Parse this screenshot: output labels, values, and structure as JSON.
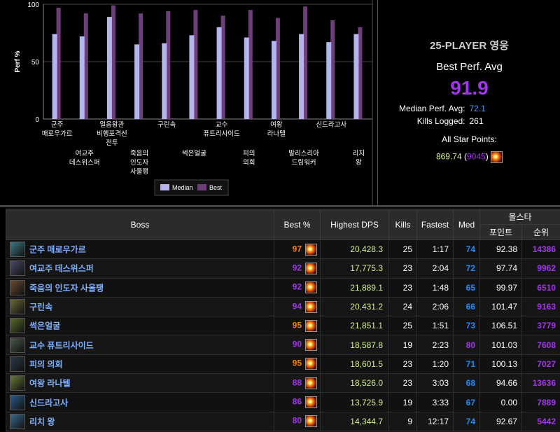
{
  "chart_data": {
    "type": "bar",
    "ylabel": "Perf %",
    "ylim": [
      0,
      100
    ],
    "yticks": [
      "0",
      "50",
      "100"
    ],
    "categories": [
      [
        "군주",
        "매로우가르"
      ],
      [
        "여교주",
        "데스위스퍼"
      ],
      [
        "얼음왕관",
        "비행포격선",
        "전투"
      ],
      [
        "죽음의",
        "인도자",
        "사울팽"
      ],
      [
        "구린속"
      ],
      [
        "썩은얼굴"
      ],
      [
        "교수",
        "퓨트리사이드"
      ],
      [
        "피의",
        "의회"
      ],
      [
        "여왕",
        "라나텔"
      ],
      [
        "발리스리아",
        "드림워커"
      ],
      [
        "신드라고사"
      ],
      [
        "리치",
        "왕"
      ]
    ],
    "series": [
      {
        "name": "Median",
        "values": [
          74,
          72,
          89,
          65,
          66,
          73,
          80,
          71,
          68,
          74,
          67,
          74
        ],
        "color": "#b4b4ee"
      },
      {
        "name": "Best",
        "values": [
          97,
          92,
          99,
          92,
          94,
          95,
          90,
          95,
          88,
          98,
          86,
          80
        ],
        "color": "#6e3e78"
      }
    ],
    "legend_placement": "bottom-center"
  },
  "stats": {
    "mode": "25-PLAYER 영웅",
    "best_perf_label": "Best Perf. Avg",
    "best_perf_value": "91.9",
    "median_label": "Median Perf. Avg:",
    "median_value": "72.1",
    "kills_label": "Kills Logged:",
    "kills_value": "261",
    "allstar_label": "All Star Points:",
    "allstar_points": "869.74",
    "allstar_rank": "9045"
  },
  "table": {
    "headers": {
      "boss": "Boss",
      "best": "Best %",
      "dps": "Highest DPS",
      "kills": "Kills",
      "fastest": "Fastest",
      "med": "Med",
      "allstar": "올스타",
      "points": "포인트",
      "rank": "순위"
    },
    "rows": [
      {
        "name": "군주 매로우가르",
        "best": "97",
        "best_color": "#ff8000",
        "dps": "20,428.3",
        "kills": "25",
        "fastest": "1:17",
        "med": "74",
        "med_color": "#1a8cff",
        "points": "92.38",
        "rank": "14386",
        "icon": "#3c7a86"
      },
      {
        "name": "여교주 데스위스퍼",
        "best": "92",
        "best_color": "#a335ee",
        "dps": "17,775.3",
        "kills": "23",
        "fastest": "2:04",
        "med": "72",
        "med_color": "#1a8cff",
        "points": "97.74",
        "rank": "9962",
        "icon": "#4a4a6a"
      },
      {
        "name": "죽음의 인도자 사울팽",
        "best": "92",
        "best_color": "#a335ee",
        "dps": "21,889.1",
        "kills": "23",
        "fastest": "1:48",
        "med": "65",
        "med_color": "#1a8cff",
        "points": "99.97",
        "rank": "6510",
        "icon": "#6a4a30"
      },
      {
        "name": "구린속",
        "best": "94",
        "best_color": "#a335ee",
        "dps": "20,431.2",
        "kills": "24",
        "fastest": "2:06",
        "med": "66",
        "med_color": "#1a8cff",
        "points": "101.47",
        "rank": "9163",
        "icon": "#6a6a3a"
      },
      {
        "name": "썩은얼굴",
        "best": "95",
        "best_color": "#ff8000",
        "dps": "21,851.1",
        "kills": "25",
        "fastest": "1:51",
        "med": "73",
        "med_color": "#1a8cff",
        "points": "106.51",
        "rank": "3779",
        "icon": "#5a6a2a"
      },
      {
        "name": "교수 퓨트리사이드",
        "best": "90",
        "best_color": "#a335ee",
        "dps": "18,587.8",
        "kills": "19",
        "fastest": "2:23",
        "med": "80",
        "med_color": "#a335ee",
        "points": "101.03",
        "rank": "7608",
        "icon": "#4a5a4a"
      },
      {
        "name": "피의 의회",
        "best": "95",
        "best_color": "#ff8000",
        "dps": "18,601.5",
        "kills": "23",
        "fastest": "1:20",
        "med": "71",
        "med_color": "#1a8cff",
        "points": "100.13",
        "rank": "7027",
        "icon": "#2a3a4a"
      },
      {
        "name": "여왕 라나텔",
        "best": "88",
        "best_color": "#a335ee",
        "dps": "18,526.0",
        "kills": "23",
        "fastest": "3:03",
        "med": "68",
        "med_color": "#1a8cff",
        "points": "94.66",
        "rank": "13636",
        "icon": "#6a7a3a"
      },
      {
        "name": "신드라고사",
        "best": "86",
        "best_color": "#a335ee",
        "dps": "13,725.9",
        "kills": "19",
        "fastest": "3:33",
        "med": "67",
        "med_color": "#1a8cff",
        "points": "0.00",
        "rank": "7889",
        "icon": "#2a5a8a"
      },
      {
        "name": "리치 왕",
        "best": "80",
        "best_color": "#a335ee",
        "dps": "14,344.7",
        "kills": "9",
        "fastest": "12:17",
        "med": "74",
        "med_color": "#1a8cff",
        "points": "92.67",
        "rank": "5442",
        "icon": "#3a6a8a"
      }
    ]
  }
}
